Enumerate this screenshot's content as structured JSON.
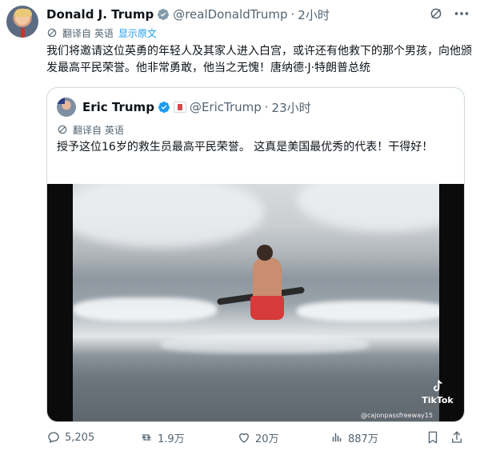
{
  "tweet": {
    "author_name": "Donald J. Trump",
    "handle": "@realDonaldTrump",
    "separator": "·",
    "time": "2小时",
    "translate_label": "翻译自 英语",
    "show_original": "显示原文",
    "text": "我们将邀请这位英勇的年轻人及其家人进入白宫，或许还有他救下的那个男孩，向他颁发最高平民荣誉。他非常勇敢，他当之无愧！唐纳德·J·特朗普总统"
  },
  "quoted": {
    "author_name": "Eric Trump",
    "handle": "@EricTrump",
    "separator": "·",
    "time": "23小时",
    "translate_label": "翻译自 英语",
    "text": "授予这位16岁的救生员最高平民荣誉。 这真是美国最优秀的代表！干得好！",
    "video": {
      "watermark_brand": "TikTok",
      "watermark_handle": "@cajonpassfreeway15"
    }
  },
  "actions": {
    "replies": "5,205",
    "reposts": "1.9万",
    "likes": "20万",
    "views": "887万"
  },
  "icons": {
    "verified": "verified-badge-icon",
    "grok": "grok-icon",
    "more": "more-icon",
    "translate": "translate-icon",
    "reply": "reply-icon",
    "repost": "repost-icon",
    "like": "heart-icon",
    "views": "views-icon",
    "bookmark": "bookmark-icon",
    "share": "share-icon"
  },
  "colors": {
    "accent": "#1d9bf0",
    "text": "#0f1419",
    "muted": "#536471",
    "border": "#cfd9de"
  }
}
